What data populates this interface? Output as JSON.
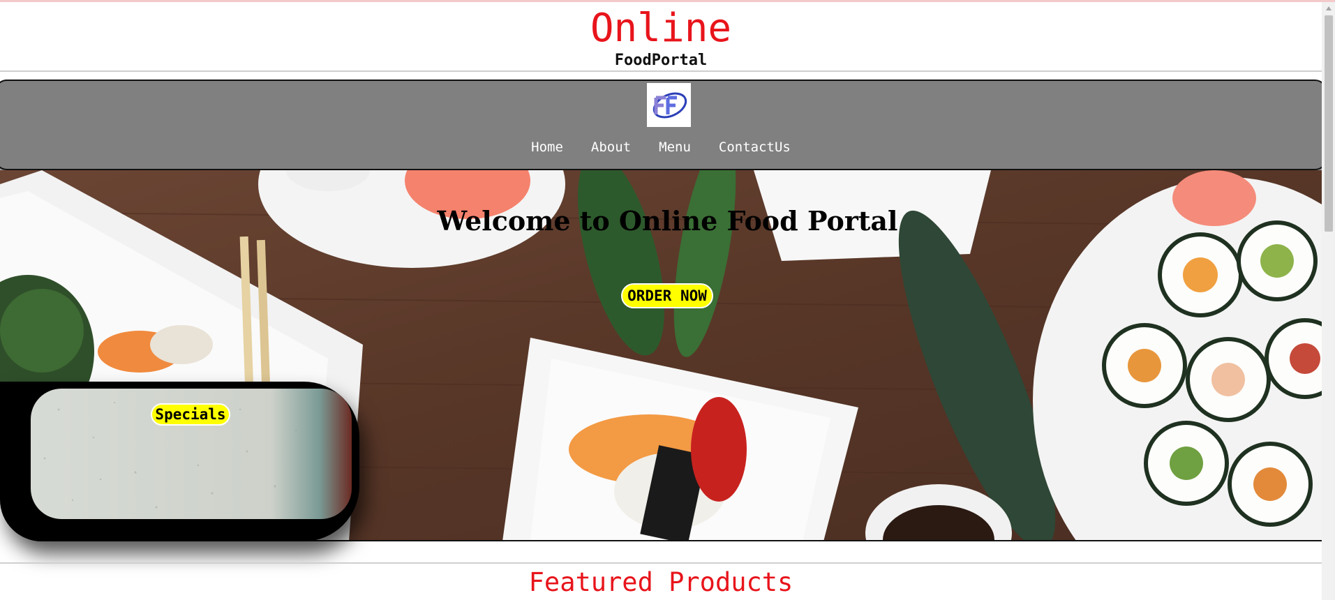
{
  "brand": {
    "title": "Online",
    "subtitle": "FoodPortal"
  },
  "logo": {
    "text": "FP",
    "icon": "fp-logo-icon"
  },
  "nav": {
    "items": [
      {
        "label": "Home"
      },
      {
        "label": "About"
      },
      {
        "label": "Menu"
      },
      {
        "label": "ContactUs"
      }
    ]
  },
  "hero": {
    "title": "Welcome to Online Food Portal",
    "order_button": "ORDER NOW",
    "image": "sushi-table-image"
  },
  "specials": {
    "label": "Specials"
  },
  "featured": {
    "title": "Featured Products"
  },
  "colors": {
    "brand_red": "#e8141b",
    "navbar_gray": "#808080",
    "button_yellow": "#ffff00"
  }
}
